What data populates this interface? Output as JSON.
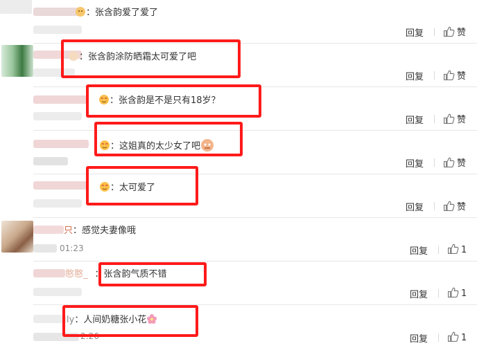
{
  "comments": [
    {
      "user_suffix": "",
      "text": "张含韵爱了爱了",
      "time": "",
      "emoji": true,
      "reply": "回复",
      "like": "赞"
    },
    {
      "user_suffix": "",
      "text": "张含韵涂防晒霜太可爱了吧",
      "time": "",
      "emoji": true,
      "reply": "回复",
      "like": "赞"
    },
    {
      "user_suffix": "",
      "text": "张含韵是不是只有18岁？",
      "time": "",
      "emoji": true,
      "reply": "回复",
      "like": "赞"
    },
    {
      "user_suffix": "",
      "text": "这姐真的太少女了吧",
      "time": "",
      "emoji": true,
      "reply": "回复",
      "like": "赞"
    },
    {
      "user_suffix": "",
      "text": "太可爱了",
      "time": "",
      "emoji": true,
      "reply": "回复",
      "like": "赞"
    },
    {
      "user_suffix": "只",
      "text": "感觉夫妻像哦",
      "time": "01:23",
      "emoji": false,
      "reply": "回复",
      "like": "1"
    },
    {
      "user_suffix": "憨憨_",
      "text": "张含韵气质不错",
      "time": "",
      "emoji": false,
      "reply": "回复",
      "like": "1"
    },
    {
      "user_suffix": "ly",
      "text": "人间奶糖张小花",
      "time": "2:26",
      "emoji": false,
      "reply": "回复",
      "like": "1"
    }
  ],
  "colon": "：",
  "highlight_color": "#ff1a1a"
}
